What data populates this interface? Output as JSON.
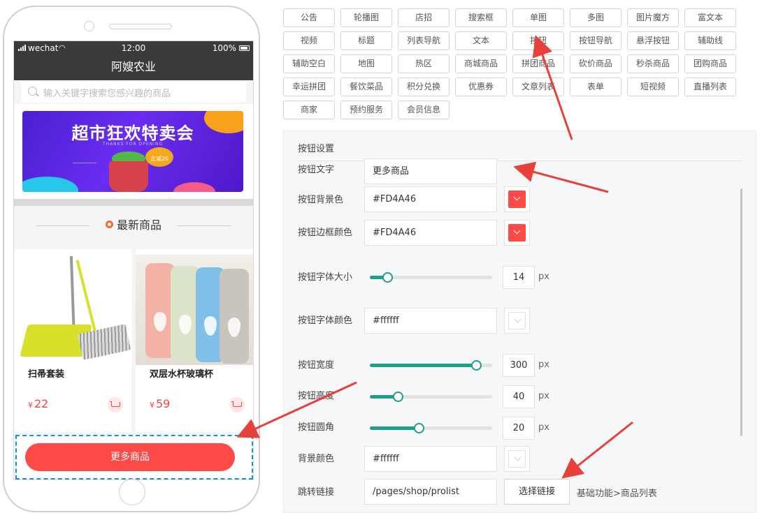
{
  "phone": {
    "carrier": "wechat",
    "time": "12:00",
    "battery": "100%",
    "page_title": "阿嫂农业",
    "search_placeholder": "输入关键字搜索您感兴趣的商品",
    "banner": {
      "title": "超市狂欢特卖会",
      "subtitle": "THANKS FOR OPENING",
      "tag": "立减20"
    },
    "section_title": "最新商品",
    "products": [
      {
        "name": "扫帚套装",
        "currency": "¥",
        "price": "22"
      },
      {
        "name": "双层水杯玻璃杯",
        "currency": "¥",
        "price": "59"
      }
    ],
    "more_button": "更多商品"
  },
  "palette": [
    "公告",
    "轮播图",
    "店招",
    "搜索框",
    "单图",
    "多图",
    "图片魔方",
    "富文本",
    "视频",
    "标题",
    "列表导航",
    "文本",
    "按钮",
    "按钮导航",
    "悬浮按钮",
    "辅助线",
    "辅助空白",
    "地图",
    "热区",
    "商城商品",
    "拼团商品",
    "砍价商品",
    "秒杀商品",
    "团购商品",
    "幸运拼团",
    "餐饮菜品",
    "积分兑换",
    "优惠券",
    "文章列表",
    "表单",
    "短视频",
    "直播列表",
    "商家",
    "预约服务",
    "会员信息"
  ],
  "settings": {
    "title": "按钮设置",
    "text_label": "按钮文字",
    "text_value": "更多商品",
    "bg_label": "按钮背景色",
    "bg_value": "#FD4A46",
    "border_label": "按钮边框颜色",
    "border_value": "#FD4A46",
    "font_size_label": "按钮字体大小",
    "font_size_value": 14,
    "font_color_label": "按钮字体颜色",
    "font_color_value": "#ffffff",
    "width_label": "按钮宽度",
    "width_value": 300,
    "height_label": "按钮高度",
    "height_value": 40,
    "radius_label": "按钮圆角",
    "radius_value": 20,
    "page_bg_label": "背景颜色",
    "page_bg_value": "#ffffff",
    "link_label": "跳转链接",
    "link_value": "/pages/shop/prolist",
    "link_button": "选择链接",
    "link_desc": "基础功能>商品列表",
    "unit": "px"
  },
  "colors": {
    "accent": "#FD4A46",
    "slider": "#1f9c8a",
    "selection_border": "#1a8fd3",
    "annotation_arrow": "#e8403a"
  }
}
